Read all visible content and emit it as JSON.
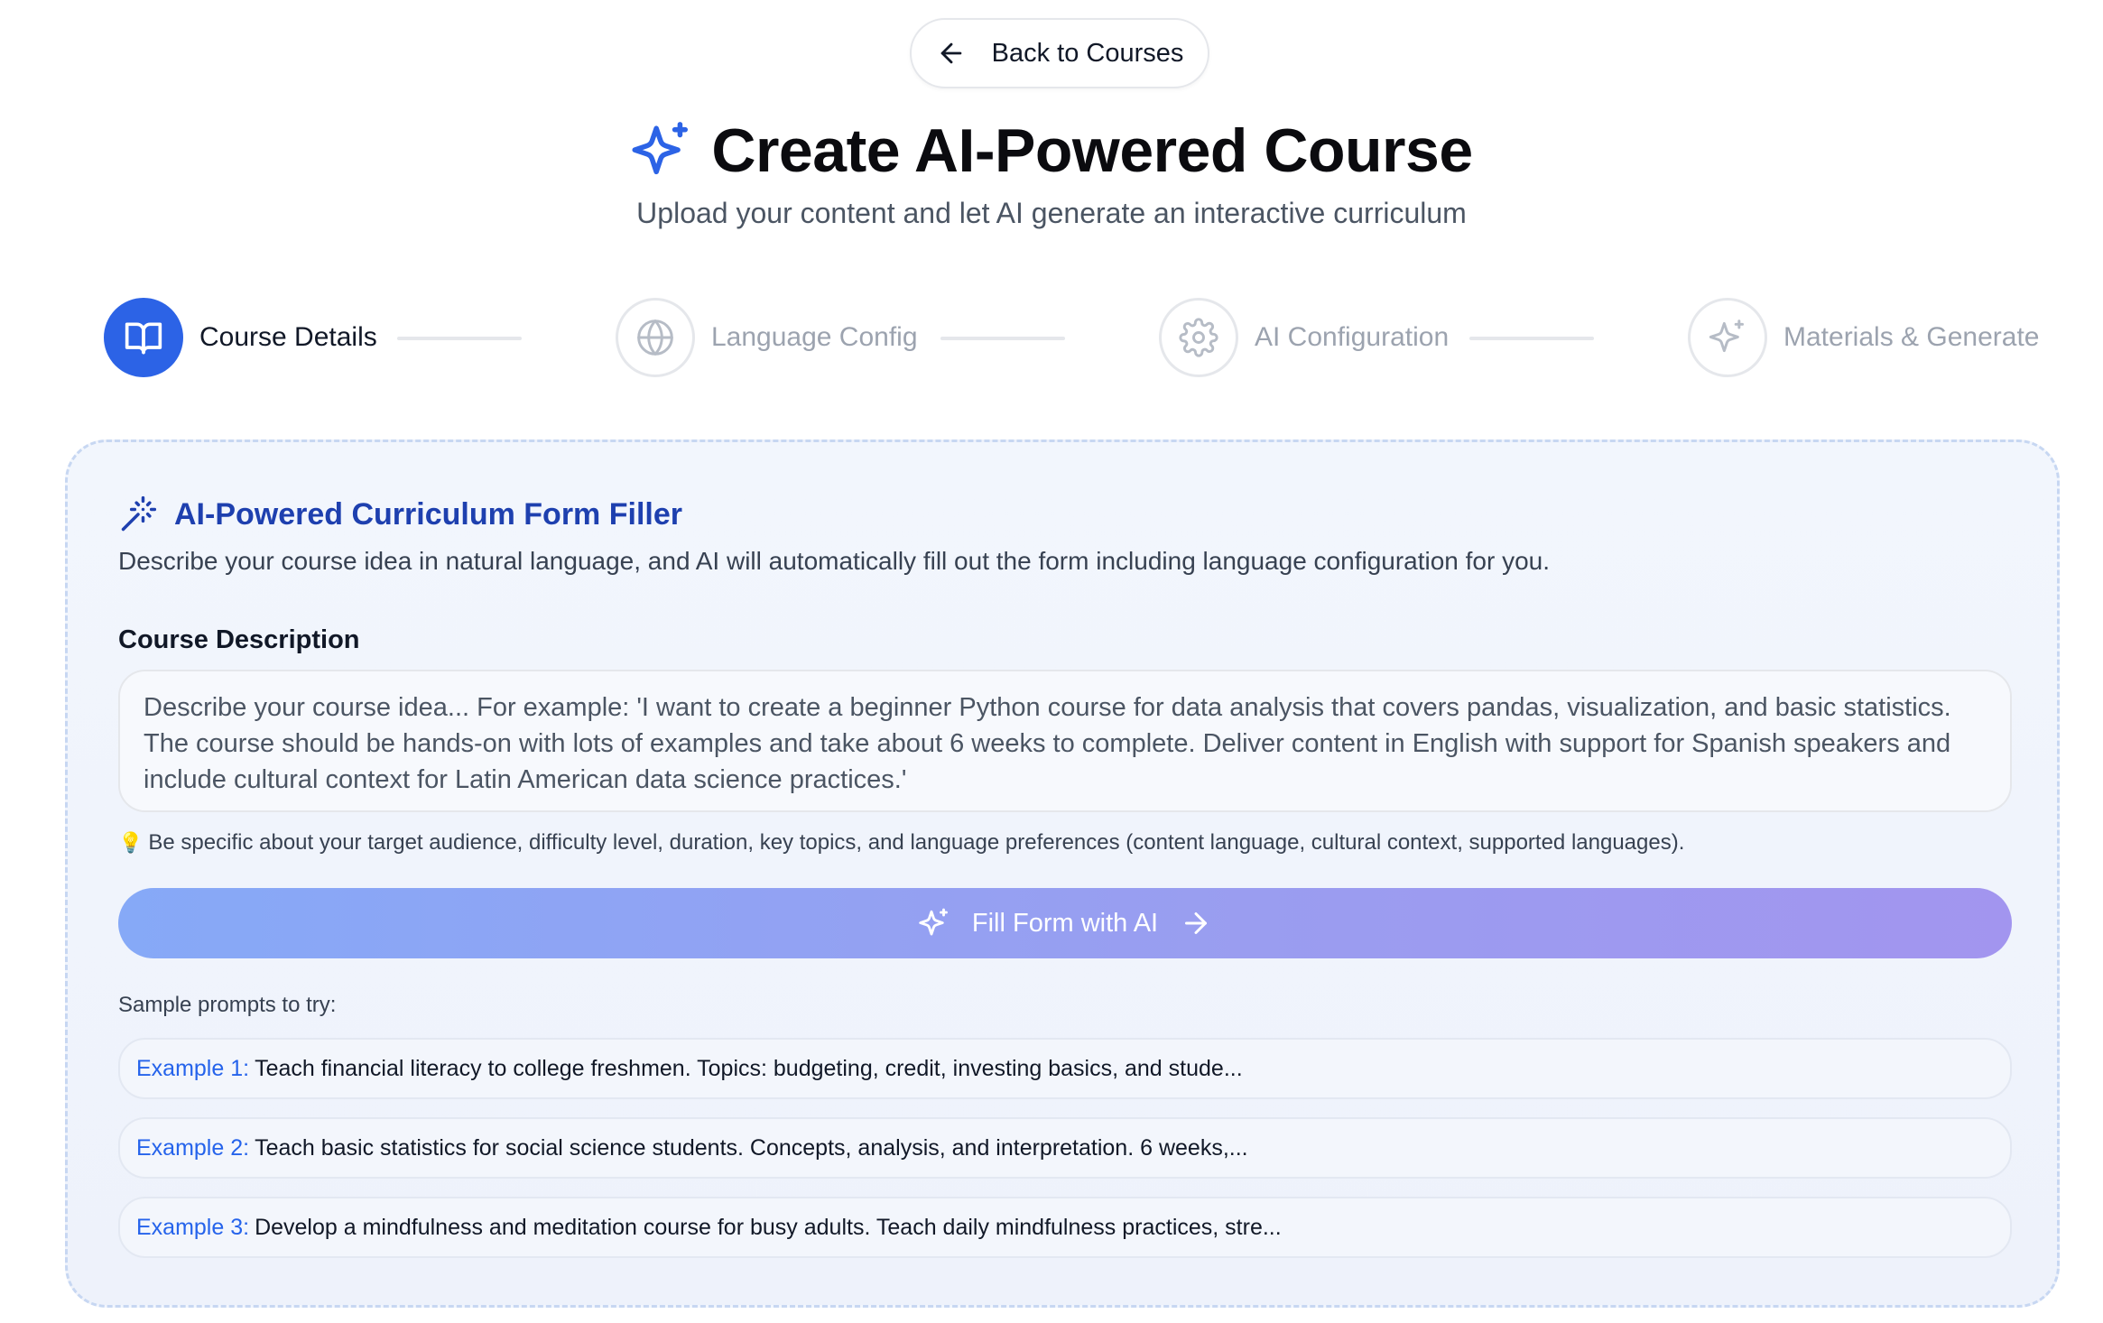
{
  "back_button": {
    "label": "Back to Courses",
    "icon": "arrow-left-icon"
  },
  "header": {
    "icon": "sparkles-icon",
    "title": "Create AI-Powered Course",
    "subtitle": "Upload your content and let AI generate an interactive curriculum"
  },
  "stepper": {
    "steps": [
      {
        "label": "Course Details",
        "icon": "book-icon",
        "active": true
      },
      {
        "label": "Language Config",
        "icon": "globe-icon",
        "active": false
      },
      {
        "label": "AI Configuration",
        "icon": "gear-icon",
        "active": false
      },
      {
        "label": "Materials & Generate",
        "icon": "sparkles-icon",
        "active": false
      }
    ]
  },
  "form_filler": {
    "icon": "magic-wand-icon",
    "title": "AI-Powered Curriculum Form Filler",
    "description": "Describe your course idea in natural language, and AI will automatically fill out the form including language configuration for you.",
    "field_label": "Course Description",
    "placeholder": "Describe your course idea... For example: 'I want to create a beginner Python course for data analysis that covers pandas, visualization, and basic statistics. The course should be hands-on with lots of examples and take about 6 weeks to complete. Deliver content in English with support for Spanish speakers and include cultural context for Latin American data science practices.'",
    "hint": "Be specific about your target audience, difficulty level, duration, key topics, and language preferences (content language, cultural context, supported languages).",
    "fill_button": "Fill Form with AI",
    "samples_label": "Sample prompts to try:",
    "examples": [
      {
        "label": "Example 1:",
        "text": "Teach financial literacy to college freshmen. Topics: budgeting, credit, investing basics, and stude..."
      },
      {
        "label": "Example 2:",
        "text": "Teach basic statistics for social science students. Concepts, analysis, and interpretation. 6 weeks,..."
      },
      {
        "label": "Example 3:",
        "text": "Develop a mindfulness and meditation course for busy adults. Teach daily mindfulness practices, stre..."
      }
    ]
  },
  "colors": {
    "accent": "#2c63e6",
    "title_blue": "#1e40af",
    "example_label": "#2563eb",
    "inactive": "#9ca3af"
  }
}
